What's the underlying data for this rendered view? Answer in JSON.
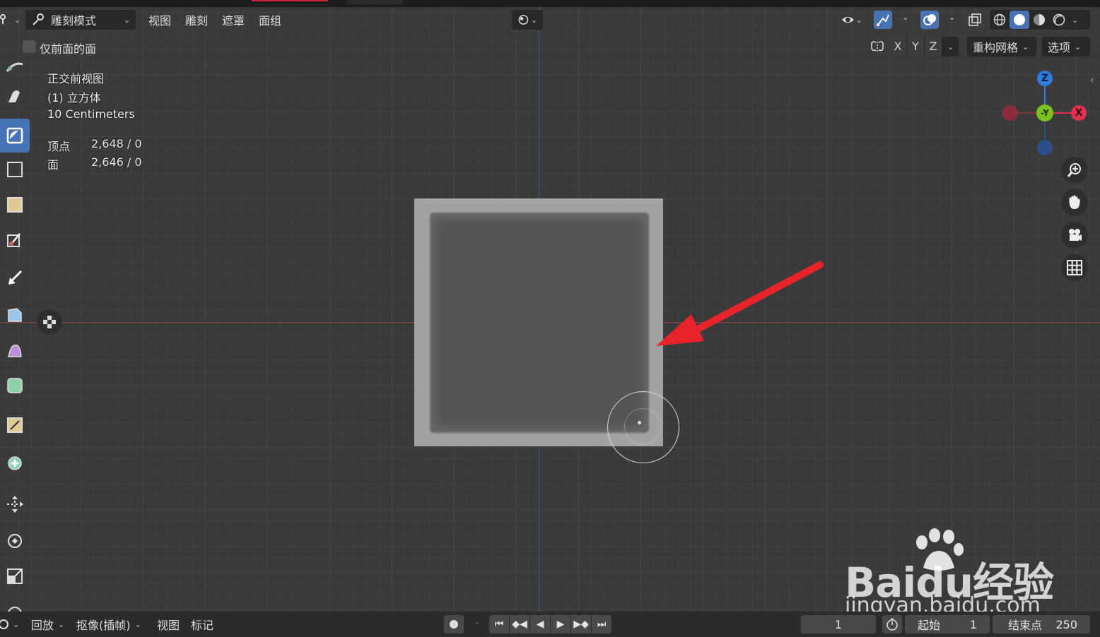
{
  "header": {
    "mode_label": "雕刻模式",
    "menus": [
      "视图",
      "雕刻",
      "遮罩",
      "面组"
    ]
  },
  "tool_header": {
    "front_faces_only_label": "仅前面的面",
    "axes": [
      "X",
      "Y",
      "Z"
    ],
    "remesh_label": "重构网格",
    "options_label": "选项"
  },
  "overlay": {
    "view_name": "正交前视图",
    "object_name": "(1) 立方体",
    "scale": "10 Centimeters",
    "stats": [
      {
        "label": "顶点",
        "value": "2,648 / 0"
      },
      {
        "label": "面",
        "value": "2,646 / 0"
      }
    ]
  },
  "gizmo": {
    "z": "Z",
    "y": "-Y",
    "x": "X"
  },
  "timeline": {
    "playback_label": "回放",
    "keying_label": "抠像(插帧)",
    "view_label": "视图",
    "marker_label": "标记",
    "current_frame": "1",
    "start_label": "起始",
    "start_value": "1",
    "end_label": "结束点",
    "end_value": "250"
  },
  "watermark": {
    "brand": "Baidu经验",
    "url": "jingyan.baidu.com"
  },
  "colors": {
    "accent": "#4772b3",
    "arrow": "#e8242a",
    "axis_x": "#e0324f",
    "axis_y": "#7cc11f",
    "axis_z": "#2f7de0"
  }
}
